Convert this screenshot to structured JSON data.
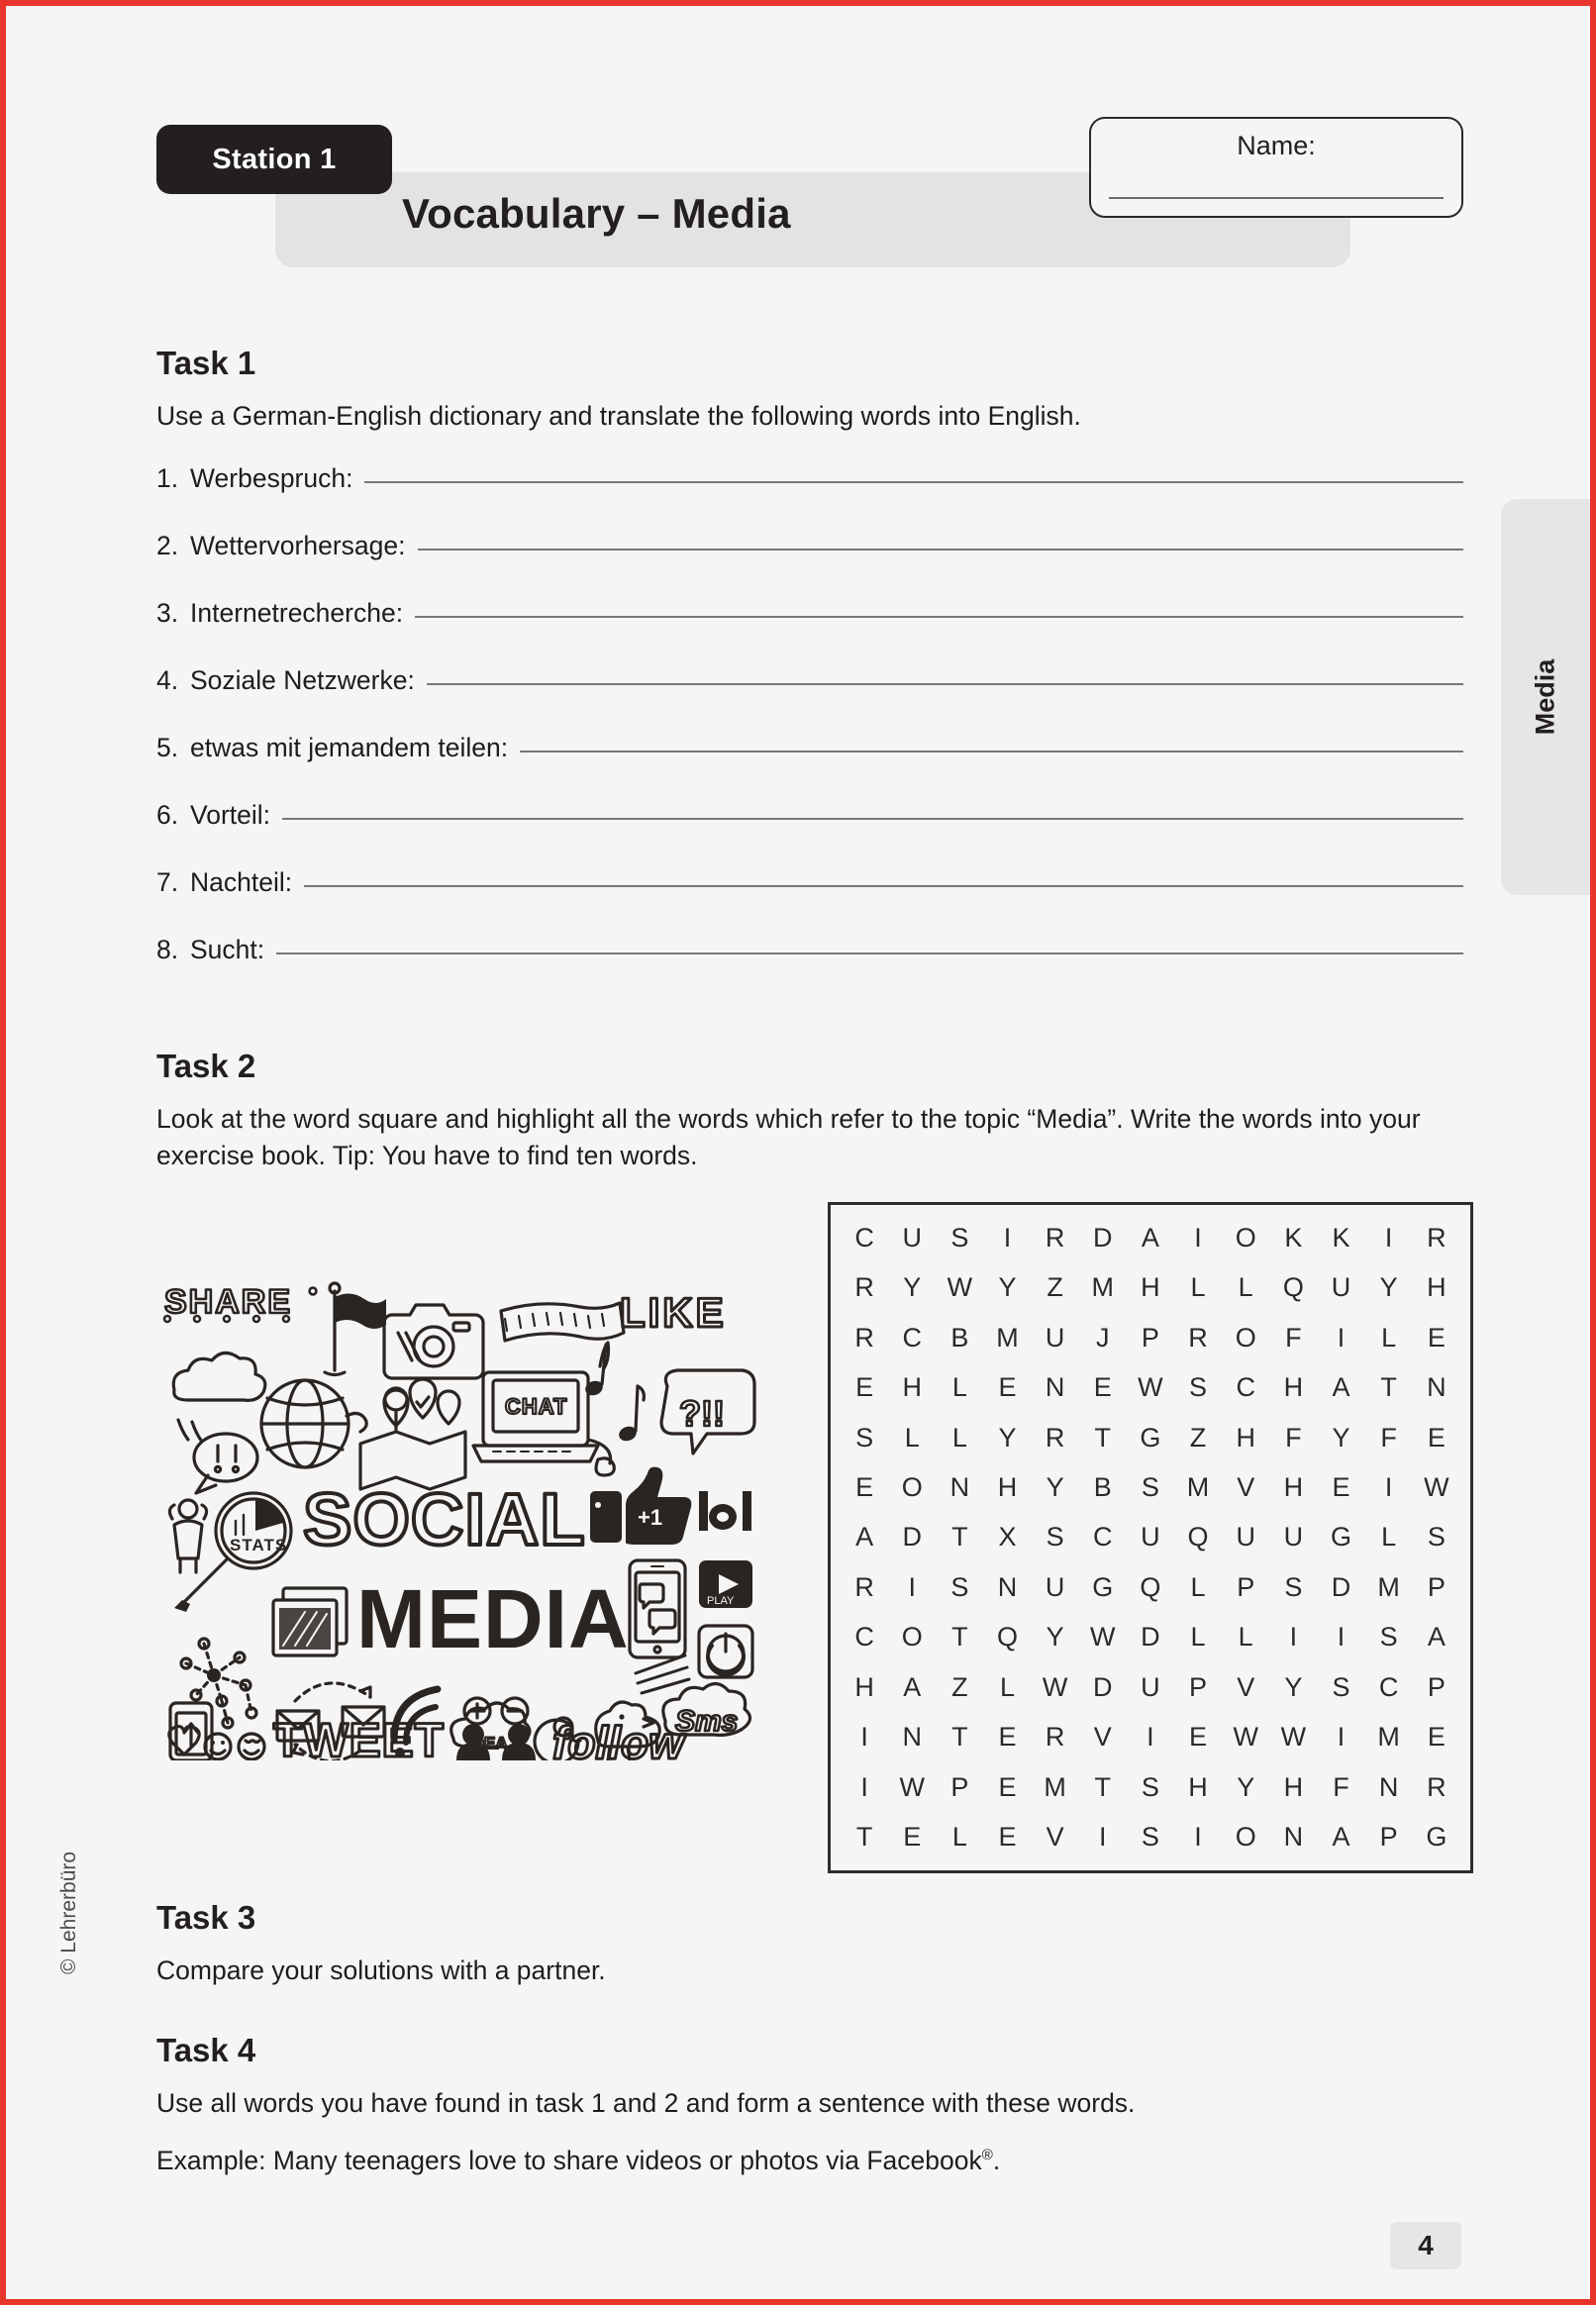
{
  "header": {
    "station_badge": "Station 1",
    "title": "Vocabulary – Media",
    "name_label": "Name:"
  },
  "side_tab": {
    "label": "Media"
  },
  "task1": {
    "heading": "Task 1",
    "instruction": "Use a German-English dictionary and translate the following words into English.",
    "items": [
      {
        "num": "1.",
        "term": "Werbespruch:"
      },
      {
        "num": "2.",
        "term": "Wettervorhersage:"
      },
      {
        "num": "3.",
        "term": "Internetrecherche:"
      },
      {
        "num": "4.",
        "term": "Soziale Netzwerke:"
      },
      {
        "num": "5.",
        "term": "etwas mit jemandem teilen:"
      },
      {
        "num": "6.",
        "term": "Vorteil:"
      },
      {
        "num": "7.",
        "term": "Nachteil:"
      },
      {
        "num": "8.",
        "term": "Sucht:"
      }
    ]
  },
  "task2": {
    "heading": "Task 2",
    "instruction": "Look at the word square and highlight all the words which refer to the topic “Media”. Write the words into your exercise book. Tip: You have to find ten words."
  },
  "word_grid": {
    "rows": 13,
    "cols": 13,
    "letters": [
      [
        "C",
        "U",
        "S",
        "I",
        "R",
        "D",
        "A",
        "I",
        "O",
        "K",
        "K",
        "I",
        "R"
      ],
      [
        "R",
        "Y",
        "W",
        "Y",
        "Z",
        "M",
        "H",
        "L",
        "L",
        "Q",
        "U",
        "Y",
        "H"
      ],
      [
        "R",
        "C",
        "B",
        "M",
        "U",
        "J",
        "P",
        "R",
        "O",
        "F",
        "I",
        "L",
        "E"
      ],
      [
        "E",
        "H",
        "L",
        "E",
        "N",
        "E",
        "W",
        "S",
        "C",
        "H",
        "A",
        "T",
        "N"
      ],
      [
        "S",
        "L",
        "L",
        "Y",
        "R",
        "T",
        "G",
        "Z",
        "H",
        "F",
        "Y",
        "F",
        "E"
      ],
      [
        "E",
        "O",
        "N",
        "H",
        "Y",
        "B",
        "S",
        "M",
        "V",
        "H",
        "E",
        "I",
        "W"
      ],
      [
        "A",
        "D",
        "T",
        "X",
        "S",
        "C",
        "U",
        "Q",
        "U",
        "U",
        "G",
        "L",
        "S"
      ],
      [
        "R",
        "I",
        "S",
        "N",
        "U",
        "G",
        "Q",
        "L",
        "P",
        "S",
        "D",
        "M",
        "P"
      ],
      [
        "C",
        "O",
        "T",
        "Q",
        "Y",
        "W",
        "D",
        "L",
        "L",
        "I",
        "I",
        "S",
        "A"
      ],
      [
        "H",
        "A",
        "Z",
        "L",
        "W",
        "D",
        "U",
        "P",
        "V",
        "Y",
        "S",
        "C",
        "P"
      ],
      [
        "I",
        "N",
        "T",
        "E",
        "R",
        "V",
        "I",
        "E",
        "W",
        "W",
        "I",
        "M",
        "E"
      ],
      [
        "I",
        "W",
        "P",
        "E",
        "M",
        "T",
        "S",
        "H",
        "Y",
        "H",
        "F",
        "N",
        "R"
      ],
      [
        "T",
        "E",
        "L",
        "E",
        "V",
        "I",
        "S",
        "I",
        "O",
        "N",
        "A",
        "P",
        "G"
      ]
    ]
  },
  "doodle": {
    "words": [
      "SHARE",
      "LIKE",
      "CHAT",
      "SOCIAL",
      "MEDIA",
      "STATS",
      "TWEET",
      "follow",
      "IDEA",
      "Sms",
      "lol",
      "?!!",
      "+1"
    ],
    "icons": [
      "flag-icon",
      "camera-icon",
      "film-strip-icon",
      "cloud-icon",
      "globe-icon",
      "map-pin-icon",
      "laptop-icon",
      "music-note-icon",
      "speech-bubble-icon",
      "person-icon",
      "magnifier-icon",
      "thumbs-up-icon",
      "photo-icon",
      "smartphone-icon",
      "play-button-icon",
      "power-button-icon",
      "network-icon",
      "envelope-icon",
      "wifi-icon",
      "plus-icon",
      "minus-icon",
      "at-sign-icon",
      "bird-icon",
      "users-icon",
      "heart-icon",
      "smiley-icon"
    ]
  },
  "task3": {
    "heading": "Task 3",
    "body": "Compare your solutions with a partner."
  },
  "task4": {
    "heading": "Task 4",
    "body": "Use all words you have found in task 1 and 2 and form a sentence with these words.",
    "example_prefix": "Example: Many teenagers love to share videos or photos via Facebook",
    "example_suffix": "."
  },
  "footer": {
    "page_number": "4",
    "copyright": "© Lehrerbüro"
  },
  "colors": {
    "page_border": "#e8352c",
    "paper": "#f5f5f5",
    "badge_dark": "#231f1e",
    "tab_grey": "#e6e6e6",
    "title_bar_grey": "#e3e3e3",
    "rule_grey": "#777777"
  }
}
